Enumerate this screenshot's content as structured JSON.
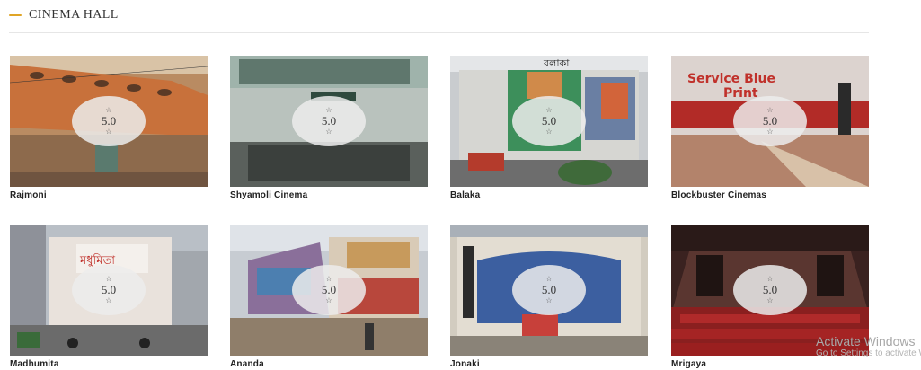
{
  "header": {
    "title": "CINEMA HALL",
    "accent_color": "#e0a526"
  },
  "halls": [
    {
      "name": "Rajmoni",
      "rating": "5.0",
      "image_text": ""
    },
    {
      "name": "Shyamoli Cinema",
      "rating": "5.0",
      "image_text": ""
    },
    {
      "name": "Balaka",
      "rating": "5.0",
      "image_text": "বলাকা"
    },
    {
      "name": "Blockbuster Cinemas",
      "rating": "5.0",
      "image_text": "Service Blue Print"
    },
    {
      "name": "Madhumita",
      "rating": "5.0",
      "image_text": "মধুমিতা"
    },
    {
      "name": "Ananda",
      "rating": "5.0",
      "image_text": ""
    },
    {
      "name": "Jonaki",
      "rating": "5.0",
      "image_text": ""
    },
    {
      "name": "Mrigaya",
      "rating": "5.0",
      "image_text": ""
    }
  ],
  "star_icon": "☆",
  "watermark": {
    "title": "Activate Windows",
    "subtitle": "Go to Settings to activate Windows."
  }
}
